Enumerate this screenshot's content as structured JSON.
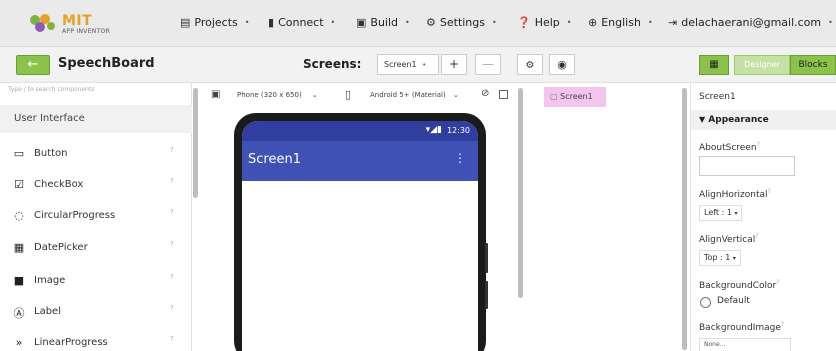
{
  "header": {
    "logo_text": "MIT",
    "logo_subtext": "APP INVENTOR",
    "menus": [
      {
        "label": "Projects"
      },
      {
        "label": "Connect"
      },
      {
        "label": "Build"
      },
      {
        "label": "Settings"
      },
      {
        "label": "Help"
      },
      {
        "label": "English"
      },
      {
        "label": "delachaerani@gmail.com"
      }
    ]
  },
  "toolbar": {
    "back_label": "←",
    "project_name": "SpeechBoard",
    "screens_label": "Screens:",
    "screen_selected": "Screen1",
    "add_label": "+",
    "remove_label": "—",
    "designer_label": "Designer",
    "blocks_label": "Blocks"
  },
  "palette": {
    "search_placeholder": "Type / to search components",
    "section": "User Interface",
    "items": [
      {
        "label": "Button",
        "icon": "button-icon"
      },
      {
        "label": "CheckBox",
        "icon": "checkbox-icon"
      },
      {
        "label": "CircularProgress",
        "icon": "circular-progress-icon"
      },
      {
        "label": "DatePicker",
        "icon": "datepicker-icon"
      },
      {
        "label": "Image",
        "icon": "image-icon"
      },
      {
        "label": "Label",
        "icon": "label-icon"
      },
      {
        "label": "LinearProgress",
        "icon": "linear-progress-icon"
      }
    ],
    "help_glyph": "?"
  },
  "viewer": {
    "device": "Phone (320 x 650)",
    "theme": "Android 5+ (Material)",
    "clock": "12:30",
    "screen_title": "Screen1",
    "more_glyph": "⋮"
  },
  "components": {
    "root": "Screen1"
  },
  "properties": {
    "component": "Screen1",
    "group": "Appearance",
    "about_screen_label": "AboutScreen",
    "align_horizontal_label": "AlignHorizontal",
    "align_horizontal_value": "Left : 1",
    "align_vertical_label": "AlignVertical",
    "align_vertical_value": "Top : 1",
    "background_color_label": "BackgroundColor",
    "background_color_value": "Default",
    "background_image_label": "BackgroundImage",
    "background_image_value": "None..."
  },
  "colors": {
    "accent_green": "#8bc34a",
    "app_bar": "#3f51b5",
    "status_bar": "#303f9f",
    "selection": "#f3c4ee"
  }
}
